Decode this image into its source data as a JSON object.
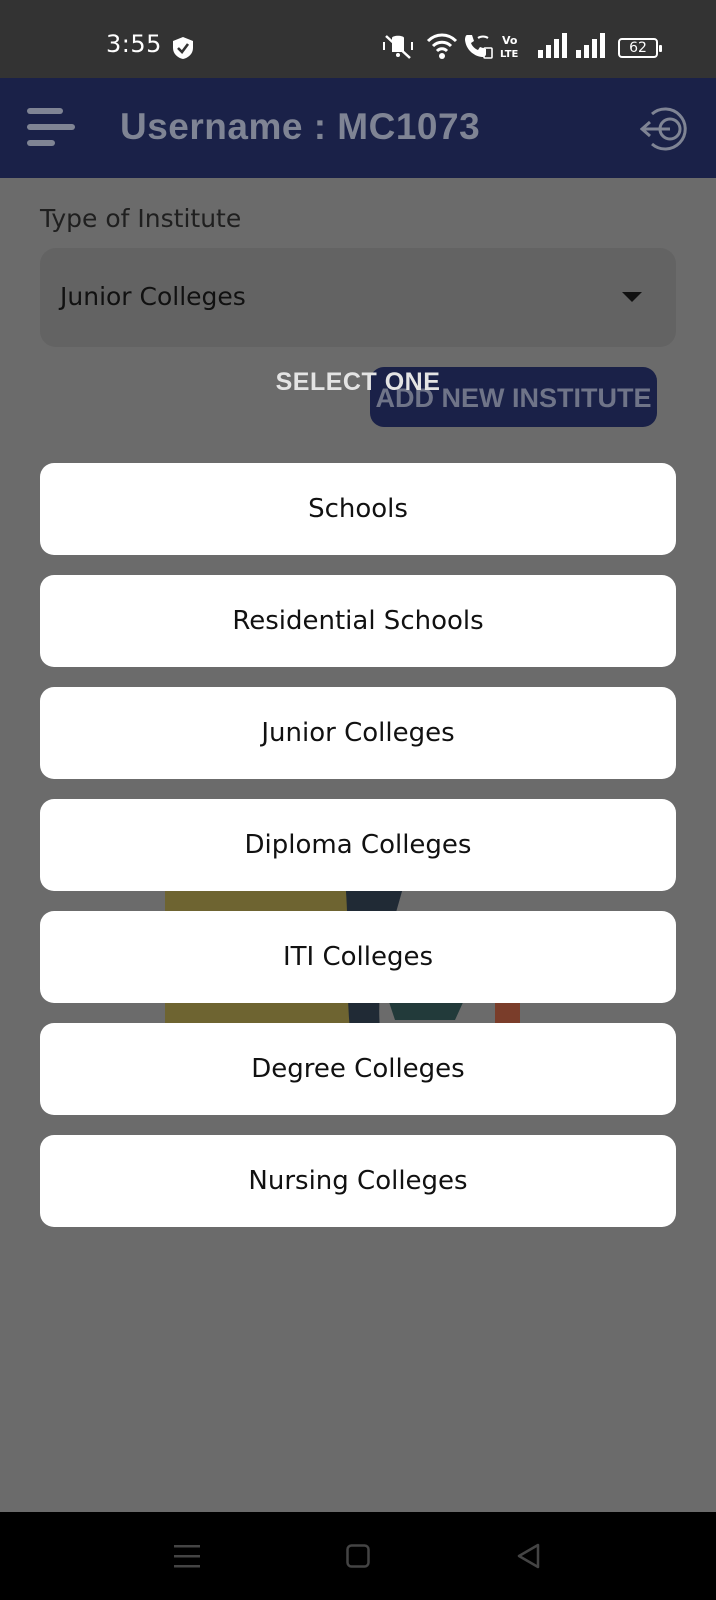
{
  "status_bar": {
    "time": "3:55",
    "battery": "62",
    "icons": [
      "shield-check-icon",
      "vibrate-mute-icon",
      "wifi-icon",
      "wifi-calling-icon",
      "volte-icon",
      "signal-icon",
      "signal-icon",
      "battery-icon"
    ]
  },
  "app_bar": {
    "title": "Username : MC1073",
    "icons": [
      "menu-icon",
      "logout-icon"
    ],
    "color": "#1a2148"
  },
  "form": {
    "type_label": "Type of Institute",
    "selected_value": "Junior Colleges",
    "add_button": "ADD NEW INSTITUTE"
  },
  "dialog": {
    "title": "SELECT ONE",
    "options": [
      "Schools",
      "Residential Schools",
      "Junior Colleges",
      "Diploma Colleges",
      "ITI Colleges",
      "Degree Colleges",
      "Nursing Colleges"
    ]
  },
  "nav_bar": {
    "icons": [
      "recents-icon",
      "home-icon",
      "back-icon"
    ]
  }
}
